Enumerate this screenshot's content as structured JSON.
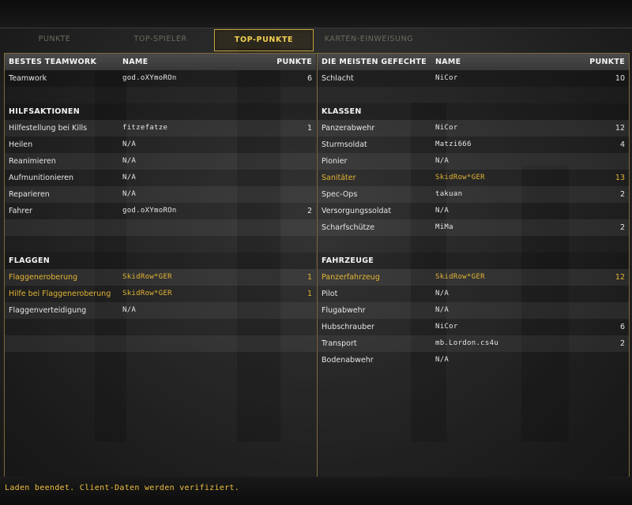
{
  "tabs": [
    {
      "label": "PUNKTE",
      "active": false
    },
    {
      "label": "TOP-SPIELER",
      "active": false
    },
    {
      "label": "TOP-PUNKTE",
      "active": true
    },
    {
      "label": "KARTEN-EINWEISUNG",
      "active": false
    }
  ],
  "left": {
    "header": {
      "c1": "BESTES TEAMWORK",
      "c2": "NAME",
      "c3": "PUNKTE"
    },
    "teamwork": [
      {
        "c1": "Teamwork",
        "c2": "god.oXYmoROn",
        "c3": "6"
      }
    ],
    "hilf_title": "HILFSAKTIONEN",
    "hilf": [
      {
        "c1": "Hilfestellung bei Kills",
        "c2": "fitzefatze",
        "c3": "1"
      },
      {
        "c1": "Heilen",
        "c2": "N/A",
        "c3": ""
      },
      {
        "c1": "Reanimieren",
        "c2": "N/A",
        "c3": ""
      },
      {
        "c1": "Aufmunitionieren",
        "c2": "N/A",
        "c3": ""
      },
      {
        "c1": "Reparieren",
        "c2": "N/A",
        "c3": ""
      },
      {
        "c1": "Fahrer",
        "c2": "god.oXYmoROn",
        "c3": "2"
      }
    ],
    "flag_title": "FLAGGEN",
    "flag": [
      {
        "c1": "Flaggeneroberung",
        "c2": "SkidRow*GER",
        "c3": "1"
      },
      {
        "c1": "Hilfe bei Flaggeneroberung",
        "c2": "SkidRow*GER",
        "c3": "1"
      },
      {
        "c1": "Flaggenverteidigung",
        "c2": "N/A",
        "c3": ""
      }
    ]
  },
  "right": {
    "header": {
      "c1": "DIE MEISTEN GEFECHTE",
      "c2": "NAME",
      "c3": "PUNKTE"
    },
    "schlacht": [
      {
        "c1": "Schlacht",
        "c2": "NiCor",
        "c3": "10"
      }
    ],
    "klassen_title": "KLASSEN",
    "klassen": [
      {
        "c1": "Panzerabwehr",
        "c2": "NiCor",
        "c3": "12"
      },
      {
        "c1": "Sturmsoldat",
        "c2": "Matzi666",
        "c3": "4"
      },
      {
        "c1": "Pionier",
        "c2": "N/A",
        "c3": ""
      },
      {
        "c1": "Sanitäter",
        "c2": "SkidRow*GER",
        "c3": "13"
      },
      {
        "c1": "Spec-Ops",
        "c2": "takuan",
        "c3": "2"
      },
      {
        "c1": "Versorgungssoldat",
        "c2": "N/A",
        "c3": ""
      },
      {
        "c1": "Scharfschütze",
        "c2": "MiMa",
        "c3": "2"
      }
    ],
    "fahr_title": "FAHRZEUGE",
    "fahr": [
      {
        "c1": "Panzerfahrzeug",
        "c2": "SkidRow*GER",
        "c3": "12"
      },
      {
        "c1": "Pilot",
        "c2": "N/A",
        "c3": ""
      },
      {
        "c1": "Flugabwehr",
        "c2": "N/A",
        "c3": ""
      },
      {
        "c1": "Hubschrauber",
        "c2": "NiCor",
        "c3": "6"
      },
      {
        "c1": "Transport",
        "c2": "mb.Lordon.cs4u",
        "c3": "2"
      },
      {
        "c1": "Bodenabwehr",
        "c2": "N/A",
        "c3": ""
      }
    ]
  },
  "status": "Laden beendet. Client-Daten werden verifiziert.",
  "colors": {
    "accent": "#e2b533",
    "frame": "#7b6a34"
  }
}
